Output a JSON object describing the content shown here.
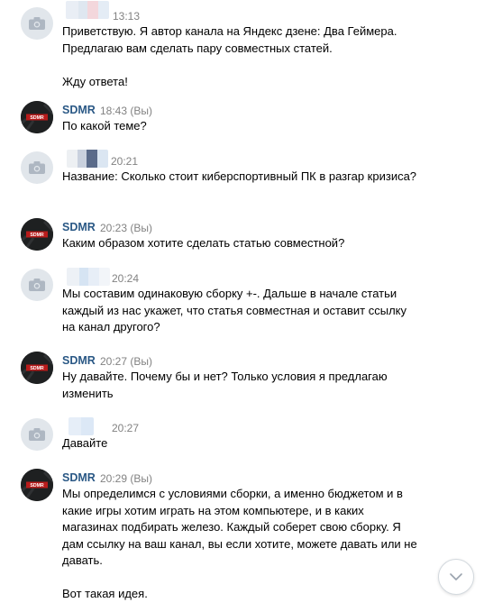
{
  "messages": [
    {
      "author": "",
      "is_self": false,
      "time": "13:13",
      "text": "Приветствую. Я автор канала на Яндекс дзене: Два Геймера. Предлагаю вам сделать пару совместных статей.\n\nЖду ответа!"
    },
    {
      "author": "SDMR",
      "is_self": true,
      "time": "18:43 (Вы)",
      "text": "По какой теме?"
    },
    {
      "author": "",
      "is_self": false,
      "time": "20:21",
      "text": "Название: Сколько стоит киберспортивный ПК в разгар кризиса?"
    },
    {
      "author": "SDMR",
      "is_self": true,
      "time": "20:23 (Вы)",
      "text": "Каким образом хотите сделать статью совместной?"
    },
    {
      "author": "",
      "is_self": false,
      "time": "20:24",
      "text": "Мы составим одинаковую сборку +-. Дальше в начале статьи каждый из нас укажет, что статья совместная и оставит ссылку на канал другого?"
    },
    {
      "author": "SDMR",
      "is_self": true,
      "time": "20:27 (Вы)",
      "text": "Ну давайте. Почему бы и нет? Только условия я предлагаю изменить"
    },
    {
      "author": "",
      "is_self": false,
      "time": "20:27",
      "text": "Давайте"
    },
    {
      "author": "SDMR",
      "is_self": true,
      "time": "20:29 (Вы)",
      "text": "Мы определимся с условиями сборки, а именно бюджетом и в какие игры хотим играть на этом компьютере, и в каких магазинах подбирать железо. Каждый соберет свою сборку. Я дам ссылку на ваш канал, вы если хотите, можете давать или не давать.\n\nВот такая идея."
    }
  ],
  "avatar_logo_text": "SDMR",
  "icons": {
    "anon_avatar": "camera-icon",
    "scroll": "chevron-down-icon"
  },
  "colors": {
    "name": "#2a5885",
    "time": "#828282",
    "avatar_bg": "#e1e6eb"
  }
}
